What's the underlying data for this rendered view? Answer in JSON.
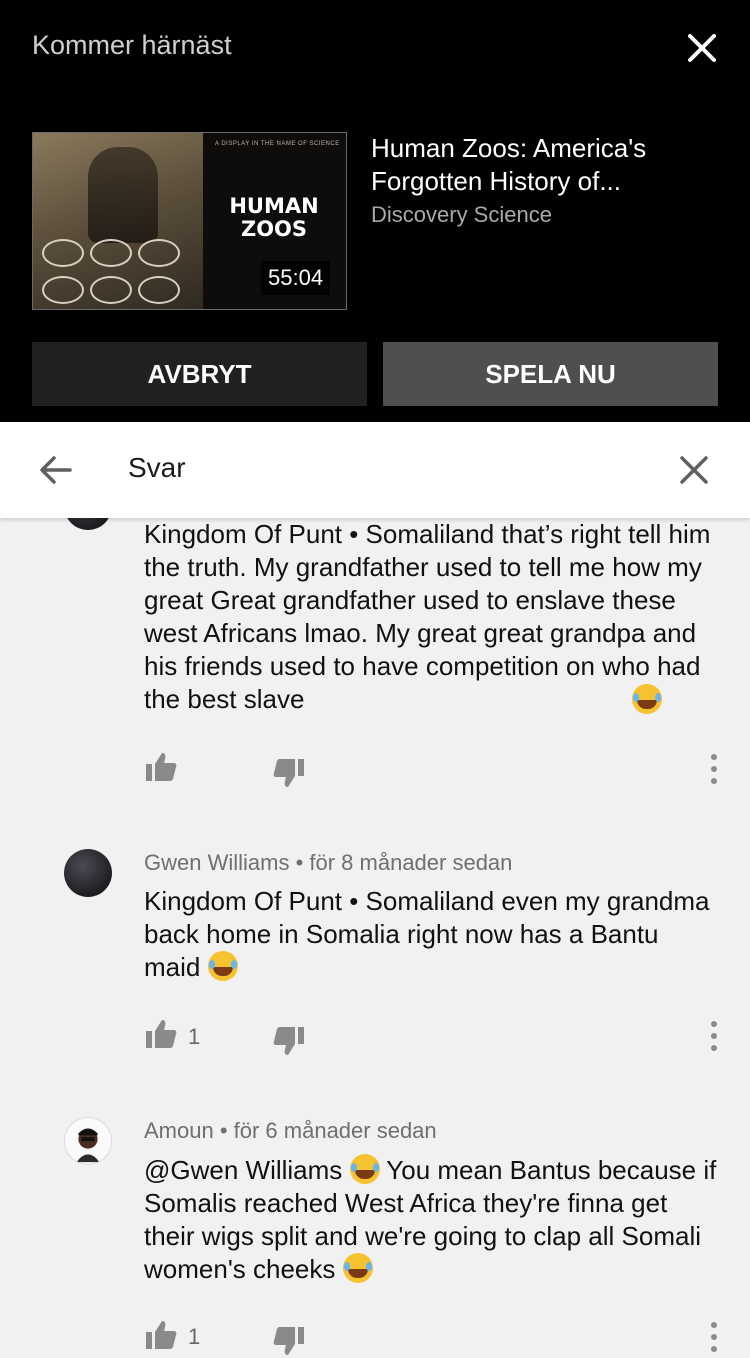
{
  "up_next": {
    "title": "Kommer härnäst",
    "thumbnail": {
      "title": "HUMAN ZOOS",
      "tagline": "A DISPLAY IN THE NAME OF SCIENCE",
      "duration": "55:04"
    },
    "video_title": "Human Zoos: America's Forgotten History of...",
    "channel": "Discovery Science",
    "cancel_label": "AVBRYT",
    "play_label": "SPELA NU"
  },
  "replies": {
    "title": "Svar"
  },
  "comments": [
    {
      "author_meta": "",
      "text": "Kingdom Of Punt • Somaliland that’s right tell him the truth. My grandfather used to tell me how my great Great grandfather used to enslave these west Africans lmao. My great great grandpa and his friends used to have competition on who had the best slave",
      "likes": ""
    },
    {
      "author_meta": "Gwen Williams • för 8 månader sedan",
      "text": "Kingdom Of Punt • Somaliland even my grandma back home in Somalia right now has a Bantu maid",
      "likes": "1"
    },
    {
      "author_meta": "Amoun • för 6 månader sedan",
      "text_before": "@Gwen Williams",
      "text_after": " You mean Bantus because if Somalis reached West Africa they're finna get their wigs split and we're going to clap all Somali women's cheeks",
      "likes": "1"
    }
  ],
  "icons": {
    "close": "close-icon",
    "back": "arrow-left-icon",
    "like": "thumb-up-icon",
    "dislike": "thumb-down-icon",
    "more": "more-vert-icon",
    "emoji": "tears-of-joy-emoji"
  }
}
